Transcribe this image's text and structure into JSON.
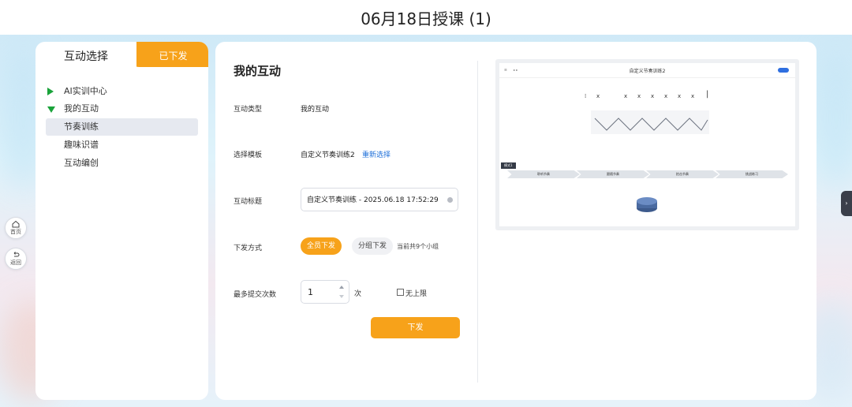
{
  "page": {
    "title": "06月18日授课 (1)"
  },
  "rail": {
    "home_label": "首页",
    "back_label": "返回"
  },
  "left_panel": {
    "tab_active": "互动选择",
    "tab_other": "已下发",
    "nav": {
      "items": [
        {
          "label": "AI实训中心",
          "expanded": false
        },
        {
          "label": "我的互动",
          "expanded": true
        }
      ],
      "sub_items": [
        "节奏训练",
        "趣味识谱",
        "互动编创"
      ],
      "selected_sub": "节奏训练"
    }
  },
  "form": {
    "section_title": "我的互动",
    "type_label": "互动类型",
    "type_value": "我的互动",
    "template_label": "选择模板",
    "template_value": "自定义节奏训练2",
    "reselect_link": "重新选择",
    "title_label": "互动标题",
    "title_value": "自定义节奏训练 - 2025.06.18 17:52:29",
    "mode_label": "下发方式",
    "mode_all": "全员下发",
    "mode_group": "分组下发",
    "group_hint": "当前共9个小组",
    "max_label": "最多提交次数",
    "max_value": "1",
    "max_unit": "次",
    "unlimited_label": "无上限",
    "submit_label": "下发"
  },
  "preview": {
    "title": "自定义节奏训练2",
    "marks": [
      "x",
      "x",
      "x",
      "x",
      "x",
      "x",
      "x"
    ],
    "steps": [
      "聆听节奏",
      "跟随节奏",
      "拍击节奏",
      "挑战练习"
    ],
    "section_tag": "模式1"
  },
  "colors": {
    "accent": "#f7a21a",
    "link": "#1e6fd9",
    "tree_arrow": "#1aa33a",
    "selected_bg": "#e6e9f0"
  }
}
